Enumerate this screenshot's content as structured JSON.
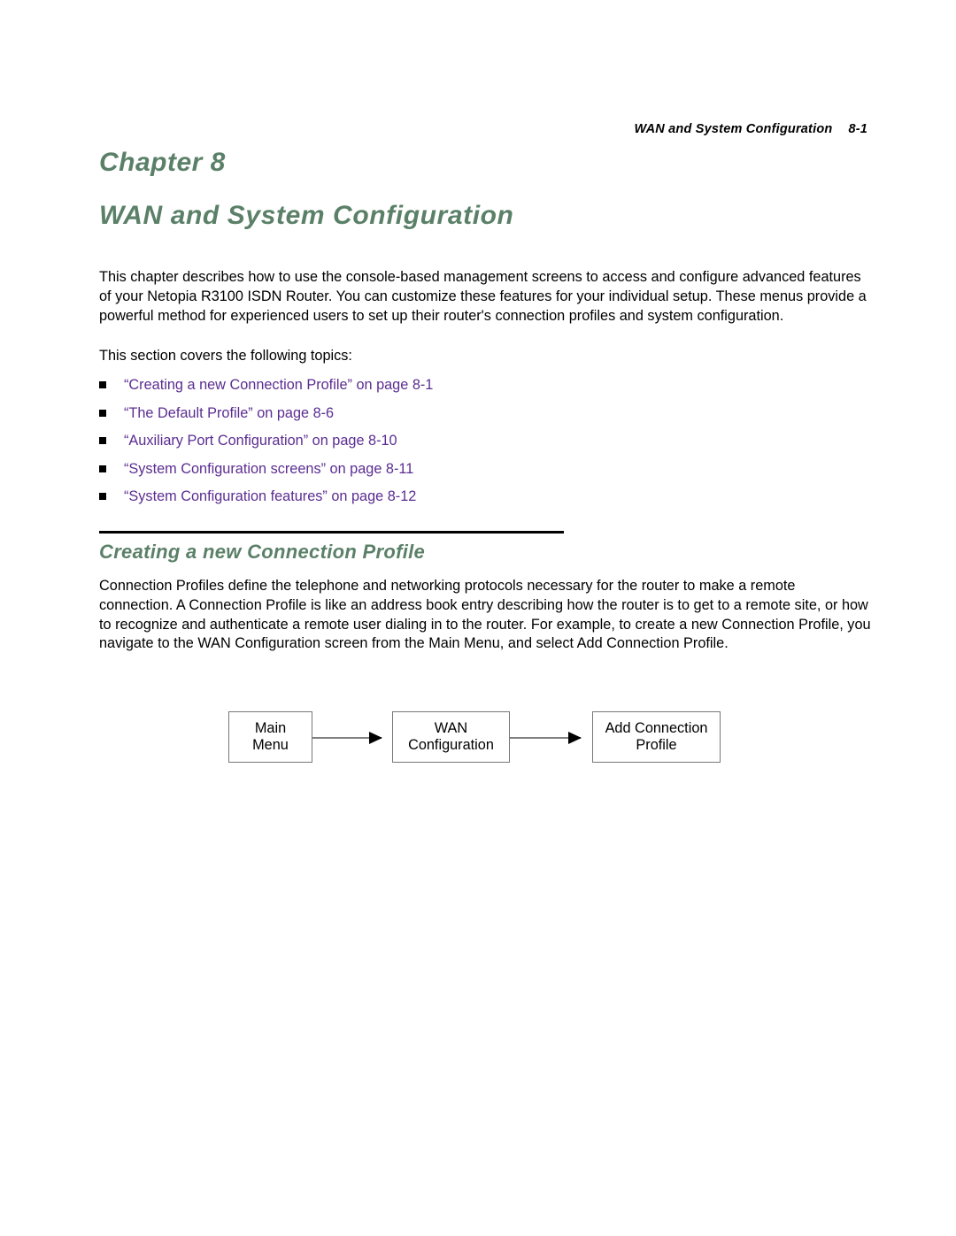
{
  "header": {
    "title": "WAN and System Configuration",
    "page_number": "8-1"
  },
  "chapter": {
    "label": "Chapter 8",
    "title": "WAN and System Configuration"
  },
  "intro": {
    "paragraph": "This chapter describes how to use the console-based management screens to access and configure advanced features of your Netopia R3100 ISDN Router. You can customize these features for your individual setup. These menus provide a powerful method for experienced users to set up their router's connection profiles and system configuration.",
    "topics_lead": "This section covers the following topics:"
  },
  "topics": [
    {
      "text": "“Creating a new Connection Profile” on page 8-1"
    },
    {
      "text": "“The Default Profile” on page 8-6"
    },
    {
      "text": "“Auxiliary Port Configuration” on page 8-10"
    },
    {
      "text": "“System Configuration screens” on page 8-11"
    },
    {
      "text": "“System Configuration features” on page 8-12"
    }
  ],
  "section": {
    "heading": "Creating a new Connection Profile",
    "paragraph": "Connection Profiles define the telephone and networking protocols necessary for the router to make a remote connection. A Connection Profile is like an address book entry describing how the router is to get to a remote site, or how to recognize and authenticate a remote user dialing in to the router. For example, to create a new Connection Profile, you navigate to the WAN Configuration screen from the Main Menu, and select Add Connection Profile."
  },
  "flow_diagram": {
    "boxes": [
      {
        "line1": "Main",
        "line2": "Menu"
      },
      {
        "line1": "WAN",
        "line2": "Configuration"
      },
      {
        "line1": "Add Connection",
        "line2": "Profile"
      }
    ]
  },
  "colors": {
    "heading_green": "#5b8068",
    "link_purple": "#5b2d91",
    "body_black": "#000000",
    "box_border_gray": "#777777",
    "arrow_gray": "#808080"
  }
}
